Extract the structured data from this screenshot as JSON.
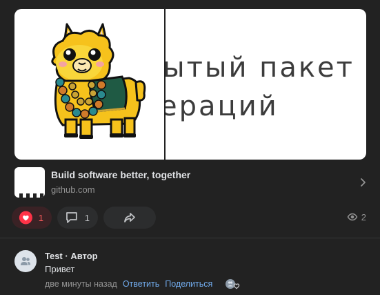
{
  "media": {
    "slide2_line1": "ытый пакет",
    "slide2_line2": "ераций"
  },
  "link_card": {
    "title": "Build software better, together",
    "domain": "github.com"
  },
  "actions": {
    "likes": "1",
    "comments": "1",
    "views": "2",
    "like_color": "#ff3347"
  },
  "comment": {
    "author": "Test · Автор",
    "text": "Привет",
    "time": "две минуты назад",
    "reply_label": "Ответить",
    "share_label": "Поделиться",
    "link_color": "#71aaeb"
  },
  "icons": [
    "llama-illustration",
    "chevron-right-icon",
    "heart-icon",
    "comment-icon",
    "share-icon",
    "eye-icon",
    "group-avatar-icon",
    "like-reaction-icon"
  ]
}
